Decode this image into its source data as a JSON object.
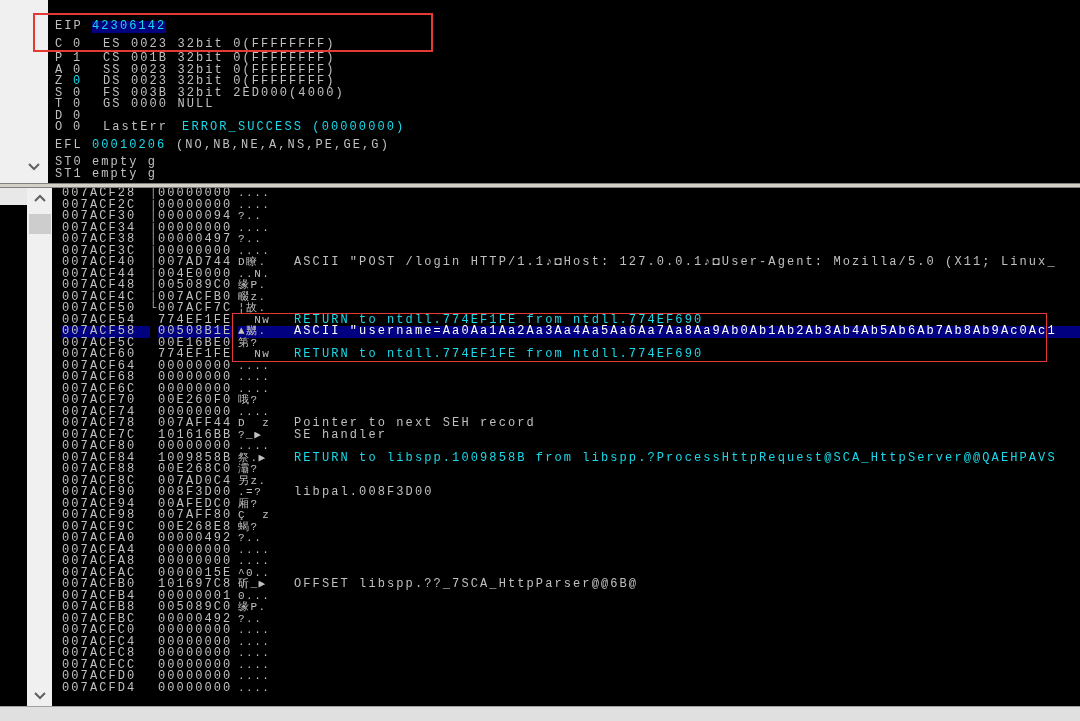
{
  "registers": [
    {
      "name": "EIP",
      "value": "42306142",
      "selected": true
    }
  ],
  "flags": [
    {
      "name": "C",
      "value": "0",
      "changed": false,
      "segment": "ES 0023 32bit 0(FFFFFFFF)"
    },
    {
      "name": "P",
      "value": "1",
      "changed": false,
      "segment": "CS 001B 32bit 0(FFFFFFFF)"
    },
    {
      "name": "A",
      "value": "0",
      "changed": false,
      "segment": "SS 0023 32bit 0(FFFFFFFF)"
    },
    {
      "name": "Z",
      "value": "0",
      "changed": true,
      "segment": "DS 0023 32bit 0(FFFFFFFF)"
    },
    {
      "name": "S",
      "value": "0",
      "changed": false,
      "segment": "FS 003B 32bit 2ED000(4000)"
    },
    {
      "name": "T",
      "value": "0",
      "changed": false,
      "segment": "GS 0000 NULL"
    },
    {
      "name": "D",
      "value": "0",
      "changed": false
    },
    {
      "name": "O",
      "value": "0",
      "changed": false,
      "segment": "LastErr",
      "segment_value": "ERROR_SUCCESS (00000000)"
    }
  ],
  "efl": {
    "name": "EFL",
    "value": "00010206",
    "note": "(NO,NB,NE,A,NS,PE,GE,G)"
  },
  "fpu": [
    {
      "name": "ST0",
      "value": "empty g"
    },
    {
      "name": "ST1",
      "value": "empty g"
    }
  ],
  "stack": [
    {
      "address": "007ACF28",
      "value": "00000000",
      "ascii": "....",
      "bracket": "│",
      "selected": false
    },
    {
      "address": "007ACF2C",
      "value": "00000000",
      "ascii": "....",
      "bracket": "│",
      "selected": false
    },
    {
      "address": "007ACF30",
      "value": "00000094",
      "ascii": "?..",
      "bracket": "│",
      "selected": false
    },
    {
      "address": "007ACF34",
      "value": "00000000",
      "ascii": "....",
      "bracket": "│",
      "selected": false
    },
    {
      "address": "007ACF38",
      "value": "00000497",
      "ascii": "?..",
      "bracket": "│",
      "selected": false
    },
    {
      "address": "007ACF3C",
      "value": "00000000",
      "ascii": "....",
      "bracket": "│",
      "selected": false
    },
    {
      "address": "007ACF40",
      "value": "007AD744",
      "ascii": "D瞭.",
      "bracket": "│",
      "selected": false,
      "comment": {
        "kind": "note",
        "text": "ASCII \"POST /login HTTP/1.1♪◘Host: 127.0.0.1♪◘User-Agent: Mozilla/5.0 (X11; Linux_"
      }
    },
    {
      "address": "007ACF44",
      "value": "004E0000",
      "ascii": "..N.",
      "bracket": "│",
      "selected": false
    },
    {
      "address": "007ACF48",
      "value": "005089C0",
      "ascii": "缘P.",
      "bracket": "│",
      "selected": false
    },
    {
      "address": "007ACF4C",
      "value": "007ACFB0",
      "ascii": "畷z.",
      "bracket": "│",
      "selected": false
    },
    {
      "address": "007ACF50",
      "value": "007ACF7C",
      "ascii": "¦故.",
      "bracket": "└",
      "selected": false
    },
    {
      "address": "007ACF54",
      "value": "774EF1FE",
      "ascii": "  Nw",
      "selected": false,
      "comment": {
        "kind": "return",
        "text": "RETURN to ntdll.774EF1FE from ntdll.774EF690"
      }
    },
    {
      "address": "007ACF58",
      "value": "00508B1E",
      "ascii": "▲嬲.",
      "selected": true,
      "comment": {
        "kind": "note",
        "text": "ASCII \"username=Aa0Aa1Aa2Aa3Aa4Aa5Aa6Aa7Aa8Aa9Ab0Ab1Ab2Ab3Ab4Ab5Ab6Ab7Ab8Ab9Ac0Ac1"
      }
    },
    {
      "address": "007ACF5C",
      "value": "00E16BE0",
      "ascii": "第?",
      "selected": false
    },
    {
      "address": "007ACF60",
      "value": "774EF1FE",
      "ascii": "  Nw",
      "selected": false,
      "comment": {
        "kind": "return",
        "text": "RETURN to ntdll.774EF1FE from ntdll.774EF690"
      }
    },
    {
      "address": "007ACF64",
      "value": "00000000",
      "ascii": "....",
      "selected": false
    },
    {
      "address": "007ACF68",
      "value": "00000000",
      "ascii": "....",
      "selected": false
    },
    {
      "address": "007ACF6C",
      "value": "00000000",
      "ascii": "....",
      "selected": false
    },
    {
      "address": "007ACF70",
      "value": "00E260F0",
      "ascii": "哦?",
      "selected": false
    },
    {
      "address": "007ACF74",
      "value": "00000000",
      "ascii": "....",
      "selected": false
    },
    {
      "address": "007ACF78",
      "value": "007AFF44",
      "ascii": "D  z",
      "selected": false,
      "comment": {
        "kind": "note",
        "text": "Pointer to next SEH record"
      }
    },
    {
      "address": "007ACF7C",
      "value": "101616BB",
      "ascii": "?_▶",
      "selected": false,
      "comment": {
        "kind": "note",
        "text": "SE handler"
      }
    },
    {
      "address": "007ACF80",
      "value": "00000000",
      "ascii": "....",
      "selected": false
    },
    {
      "address": "007ACF84",
      "value": "1009858B",
      "ascii": "祭.▶",
      "selected": false,
      "comment": {
        "kind": "return",
        "text": "RETURN to libspp.1009858B from libspp.?ProcessHttpRequest@SCA_HttpServer@@QAEHPAVS"
      }
    },
    {
      "address": "007ACF88",
      "value": "00E268C0",
      "ascii": "灞?",
      "selected": false
    },
    {
      "address": "007ACF8C",
      "value": "007AD0C4",
      "ascii": "另z.",
      "selected": false
    },
    {
      "address": "007ACF90",
      "value": "008F3D00",
      "ascii": ".=?",
      "selected": false,
      "comment": {
        "kind": "note",
        "text": "libpal.008F3D00"
      }
    },
    {
      "address": "007ACF94",
      "value": "00AFEDC0",
      "ascii": "厢?",
      "selected": false
    },
    {
      "address": "007ACF98",
      "value": "007AFF80",
      "ascii": "Ç  z",
      "selected": false
    },
    {
      "address": "007ACF9C",
      "value": "00E268E8",
      "ascii": "蝎?",
      "selected": false
    },
    {
      "address": "007ACFA0",
      "value": "00000492",
      "ascii": "?..",
      "selected": false
    },
    {
      "address": "007ACFA4",
      "value": "00000000",
      "ascii": "....",
      "selected": false
    },
    {
      "address": "007ACFA8",
      "value": "00000000",
      "ascii": "....",
      "selected": false
    },
    {
      "address": "007ACFAC",
      "value": "0000015E",
      "ascii": "^0..",
      "selected": false
    },
    {
      "address": "007ACFB0",
      "value": "101697C8",
      "ascii": "斫_▶",
      "selected": false,
      "comment": {
        "kind": "note",
        "text": "OFFSET libspp.??_7SCA_HttpParser@@6B@"
      }
    },
    {
      "address": "007ACFB4",
      "value": "00000001",
      "ascii": "0...",
      "selected": false
    },
    {
      "address": "007ACFB8",
      "value": "005089C0",
      "ascii": "缘P.",
      "selected": false
    },
    {
      "address": "007ACFBC",
      "value": "00000492",
      "ascii": "?..",
      "selected": false
    },
    {
      "address": "007ACFC0",
      "value": "00000000",
      "ascii": "....",
      "selected": false
    },
    {
      "address": "007ACFC4",
      "value": "00000000",
      "ascii": "....",
      "selected": false
    },
    {
      "address": "007ACFC8",
      "value": "00000000",
      "ascii": "....",
      "selected": false
    },
    {
      "address": "007ACFCC",
      "value": "00000000",
      "ascii": "....",
      "selected": false
    },
    {
      "address": "007ACFD0",
      "value": "00000000",
      "ascii": "....",
      "selected": false
    },
    {
      "address": "007ACFD4",
      "value": "00000000",
      "ascii": "....",
      "selected": false
    }
  ]
}
